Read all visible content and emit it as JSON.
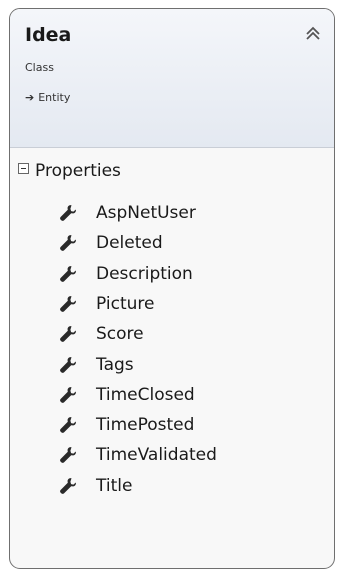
{
  "class": {
    "name": "Idea",
    "stereotype": "Class",
    "base": "Entity"
  },
  "section": {
    "label": "Properties"
  },
  "properties": [
    "AspNetUser",
    "Deleted",
    "Description",
    "Picture",
    "Score",
    "Tags",
    "TimeClosed",
    "TimePosted",
    "TimeValidated",
    "Title"
  ],
  "icons": {
    "collapse": "double-chevron-up-icon",
    "base": "inherit-arrow-icon",
    "section_toggle": "minus-box-icon",
    "property": "wrench-icon"
  },
  "colors": {
    "header_top": "#f4f6fa",
    "header_bottom": "#e4e9f1",
    "border": "#6f6f6f"
  }
}
